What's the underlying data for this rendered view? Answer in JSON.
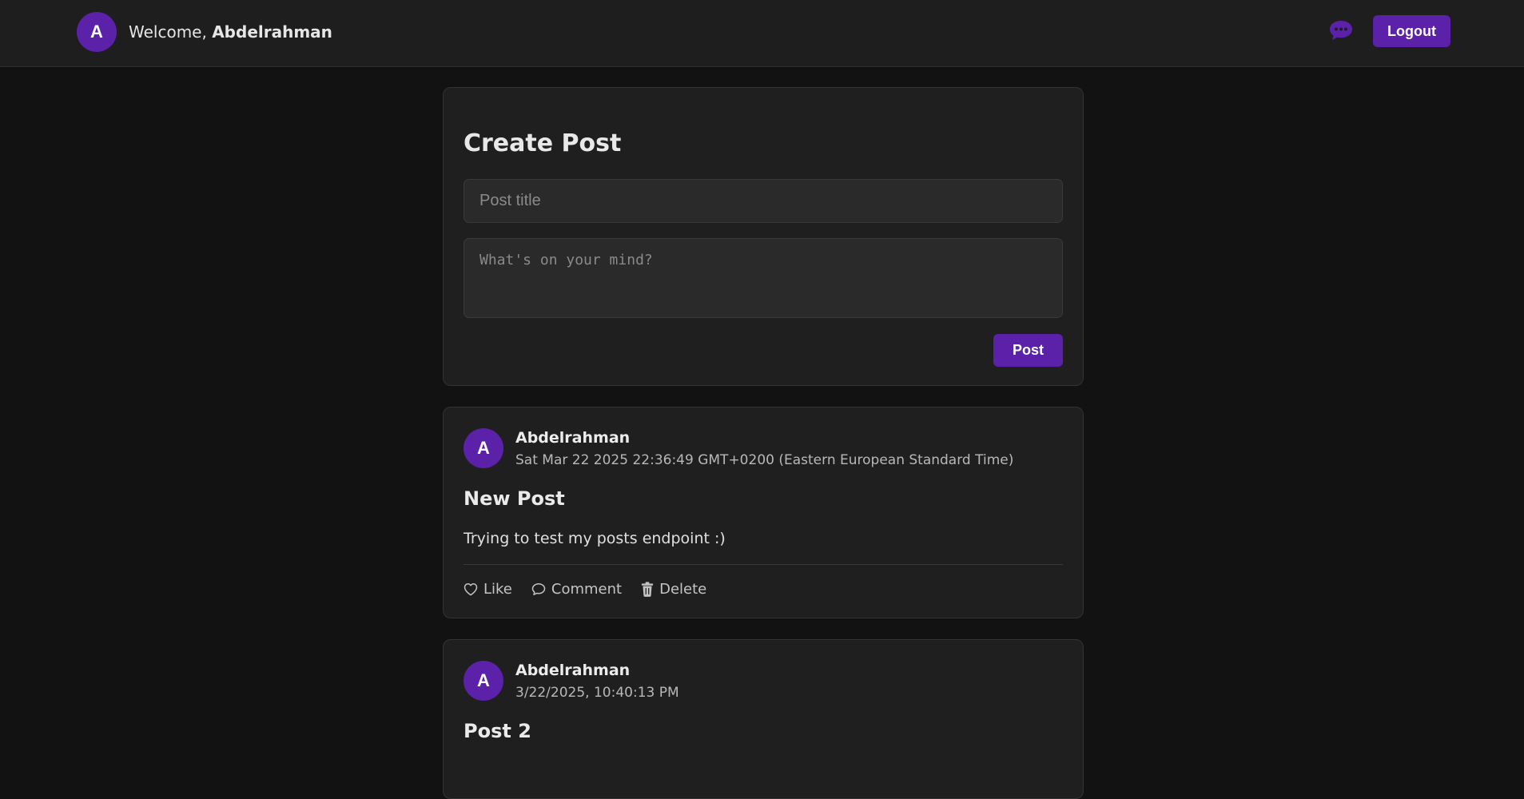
{
  "header": {
    "avatar_letter": "A",
    "welcome_prefix": "Welcome, ",
    "username": "Abdelrahman",
    "chat_icon": "chat-bubble-icon",
    "logout_label": "Logout"
  },
  "create_post": {
    "title": "Create Post",
    "title_placeholder": "Post title",
    "content_placeholder": "What's on your mind?",
    "post_label": "Post"
  },
  "posts": [
    {
      "avatar_letter": "A",
      "author": "Abdelrahman",
      "timestamp": "Sat Mar 22 2025 22:36:49 GMT+0200 (Eastern European Standard Time)",
      "title": "New Post",
      "body": "Trying to test my posts endpoint :)",
      "like_label": "Like",
      "comment_label": "Comment",
      "delete_label": "Delete"
    },
    {
      "avatar_letter": "A",
      "author": "Abdelrahman",
      "timestamp": "3/22/2025, 10:40:13 PM",
      "title": "Post 2"
    }
  ],
  "colors": {
    "accent": "#5b21a8",
    "background": "#121212",
    "card": "#1f1f1f"
  }
}
